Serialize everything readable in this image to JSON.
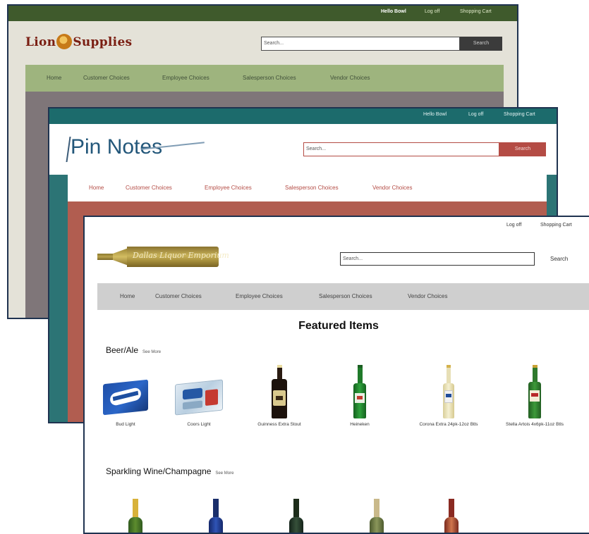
{
  "lion": {
    "greeting": "Hello Bowl",
    "logoff": "Log off",
    "cart": "Shopping Cart",
    "brand_left": "Lion",
    "brand_right": "Supplies",
    "search_placeholder": "Search...",
    "search_button": "Search",
    "nav": [
      "Home",
      "Customer Choices",
      "Employee Choices",
      "Salesperson Choices",
      "Vendor Choices"
    ],
    "colors": {
      "topbar": "#3f5a2c",
      "nav": "#9eb47e",
      "body": "#7f7679"
    }
  },
  "pin": {
    "greeting": "Hello Bowl",
    "logoff": "Log off",
    "cart": "Shopping Cart",
    "brand": "Pin Notes",
    "search_placeholder": "Search...",
    "search_button": "Search",
    "nav": [
      "Home",
      "Customer Choices",
      "Employee Choices",
      "Salesperson Choices",
      "Vendor Choices"
    ],
    "colors": {
      "topbar": "#1c6b6c",
      "accent": "#b44c45",
      "body": "#b15d50"
    }
  },
  "wine": {
    "logoff": "Log off",
    "cart": "Shopping Cart",
    "logo_text": "Dallas Liquor Emporium",
    "search_placeholder": "Search...",
    "search_button": "Search",
    "nav": [
      "Home",
      "Customer Choices",
      "Employee Choices",
      "Salesperson Choices",
      "Vendor Choices"
    ],
    "featured_title": "Featured Items",
    "categories": [
      {
        "title": "Beer/Ale",
        "more": "See More",
        "items": [
          {
            "name": "Bud Light",
            "icon": "bud-light-case-icon"
          },
          {
            "name": "Coors Light",
            "icon": "coors-light-case-icon"
          },
          {
            "name": "Guinness Extra Stout",
            "icon": "guinness-bottle-icon"
          },
          {
            "name": "Heineken",
            "icon": "heineken-bottle-icon"
          },
          {
            "name": "Corona Extra 24pk-12oz Btls",
            "icon": "corona-bottle-icon"
          },
          {
            "name": "Stella Artois 4x6pk-11oz Btls",
            "icon": "stella-bottle-icon"
          }
        ]
      },
      {
        "title": "Sparkling Wine/Champagne",
        "more": "See More",
        "items": [
          {
            "name": "",
            "icon": "champagne-bottle-green-gold-icon"
          },
          {
            "name": "",
            "icon": "champagne-bottle-blue-icon"
          },
          {
            "name": "",
            "icon": "champagne-bottle-dark-green-icon"
          },
          {
            "name": "",
            "icon": "champagne-bottle-olive-icon"
          },
          {
            "name": "",
            "icon": "champagne-bottle-rose-icon"
          }
        ]
      }
    ]
  }
}
